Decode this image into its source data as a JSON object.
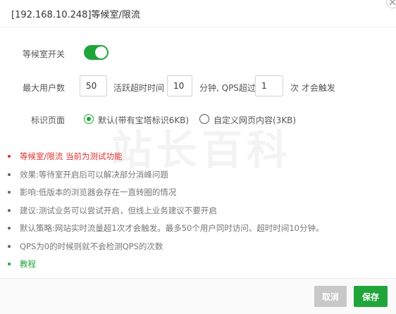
{
  "dialog": {
    "title": "[192.168.10.248]等候室/限流"
  },
  "form": {
    "waiting_room_label": "等候室开关",
    "waiting_room_enabled": true,
    "max_users_label": "最大用户数",
    "max_users_value": "50",
    "active_timeout_label": "活跃超时时间",
    "active_timeout_value": "10",
    "qps_label": "分钟, QPS超过",
    "qps_value": "1",
    "qps_suffix": "次 才会触发",
    "identity_page_label": "标识页面",
    "options": [
      {
        "label": "默认(带有宝塔标识6KB)",
        "checked": true
      },
      {
        "label": "自定义网页内容(3KB)",
        "checked": false
      }
    ]
  },
  "watermark": "站长百科",
  "notes": [
    {
      "text": "等候室/限流 当前为测试功能",
      "style": "red"
    },
    {
      "text": "效果:等待室开启后可以解决部分消峰问题",
      "style": "normal"
    },
    {
      "text": "影响:低版本的浏览器会存在一直转圈的情况",
      "style": "normal"
    },
    {
      "text": "建议:测试业务可以尝试开启，但线上业务建议不要开启",
      "style": "normal"
    },
    {
      "text": "默认策略:网站实时流量超1次才会触发。最多50个用户同时访问、超时时间10分钟。",
      "style": "normal"
    },
    {
      "text": "QPS为0的时候则就不会检测QPS的次数",
      "style": "normal"
    },
    {
      "text": "教程",
      "style": "green"
    }
  ],
  "footer": {
    "cancel_label": "取消",
    "save_label": "保存"
  },
  "colors": {
    "accent": "#20a53a",
    "warning": "#e02f2f",
    "cancel_disabled": "#c8c8c8"
  }
}
